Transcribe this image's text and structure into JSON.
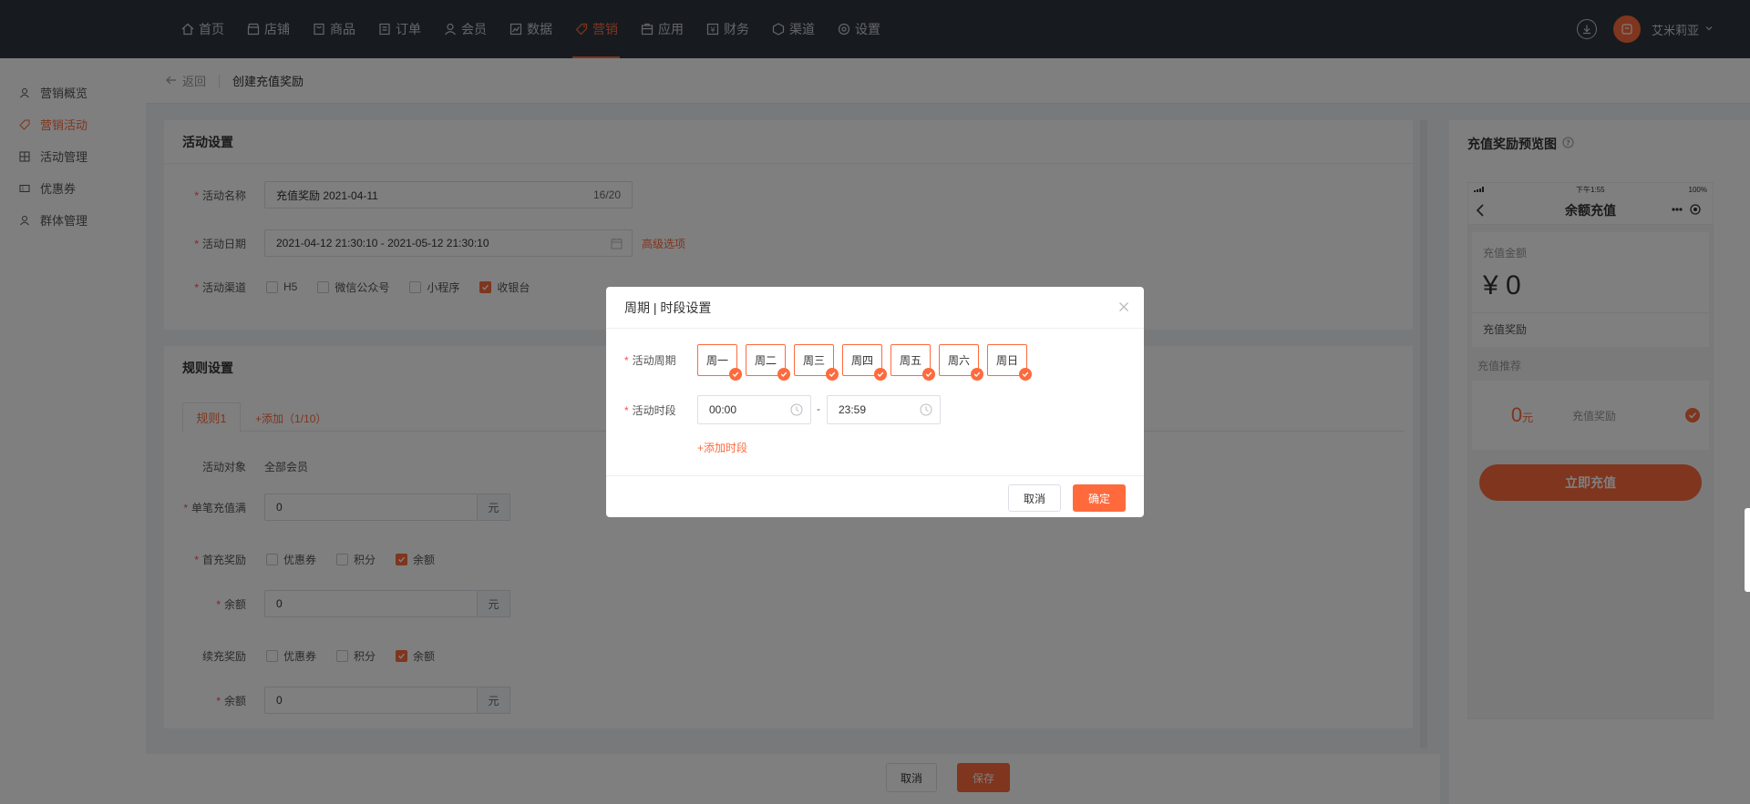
{
  "nav": {
    "items": [
      "首页",
      "店铺",
      "商品",
      "订单",
      "会员",
      "数据",
      "营销",
      "应用",
      "财务",
      "渠道",
      "设置"
    ],
    "active_index": 6,
    "user": "艾米莉亚"
  },
  "sidebar": {
    "items": [
      "营销概览",
      "营销活动",
      "活动管理",
      "优惠券",
      "群体管理"
    ],
    "active_index": 1
  },
  "breadcrumb": {
    "back": "返回",
    "title": "创建充值奖励"
  },
  "activity": {
    "title": "活动设置",
    "name_label": "活动名称",
    "name_value": "充值奖励  2021-04-11",
    "name_count": "16/20",
    "date_label": "活动日期",
    "date_value": "2021-04-12 21:30:10 - 2021-05-12 21:30:10",
    "advanced": "高级选项",
    "channel_label": "活动渠道",
    "channels": [
      {
        "label": "H5",
        "checked": false
      },
      {
        "label": "微信公众号",
        "checked": false
      },
      {
        "label": "小程序",
        "checked": false
      },
      {
        "label": "收银台",
        "checked": true
      }
    ]
  },
  "rules": {
    "title": "规则设置",
    "tab": "规则1",
    "add": "+添加（1/10）",
    "target_label": "活动对象",
    "target_value": "全部会员",
    "single_label": "单笔充值满",
    "single_value": "0",
    "unit": "元",
    "first_label": "首充奖励",
    "first_opts": [
      {
        "label": "优惠券",
        "checked": false
      },
      {
        "label": "积分",
        "checked": false
      },
      {
        "label": "余额",
        "checked": true
      }
    ],
    "balance_label": "余额",
    "balance_value": "0",
    "renew_label": "续充奖励",
    "renew_opts": [
      {
        "label": "优惠券",
        "checked": false
      },
      {
        "label": "积分",
        "checked": false
      },
      {
        "label": "余额",
        "checked": true
      }
    ],
    "balance2_label": "余额",
    "balance2_value": "0"
  },
  "footer": {
    "cancel": "取消",
    "save": "保存"
  },
  "preview": {
    "title": "充值奖励预览图",
    "status_time": "下午1:55",
    "status_battery": "100%",
    "page_title": "余额充值",
    "amount_label": "充值金额",
    "amount": "¥ 0",
    "reward_label": "充值奖励",
    "recommend": "充值推荐",
    "rec_value": "0",
    "rec_unit": "元",
    "rec_reward": "充值奖励",
    "pay_button": "立即充值"
  },
  "modal": {
    "title": "周期 | 时段设置",
    "period_label": "活动周期",
    "days": [
      "周一",
      "周二",
      "周三",
      "周四",
      "周五",
      "周六",
      "周日"
    ],
    "time_label": "活动时段",
    "start": "00:00",
    "end": "23:59",
    "sep": "-",
    "add_slot": "+添加时段",
    "cancel": "取消",
    "ok": "确定"
  },
  "colors": {
    "accent": "#ff6a3d",
    "nav_bg": "#2f3640"
  }
}
